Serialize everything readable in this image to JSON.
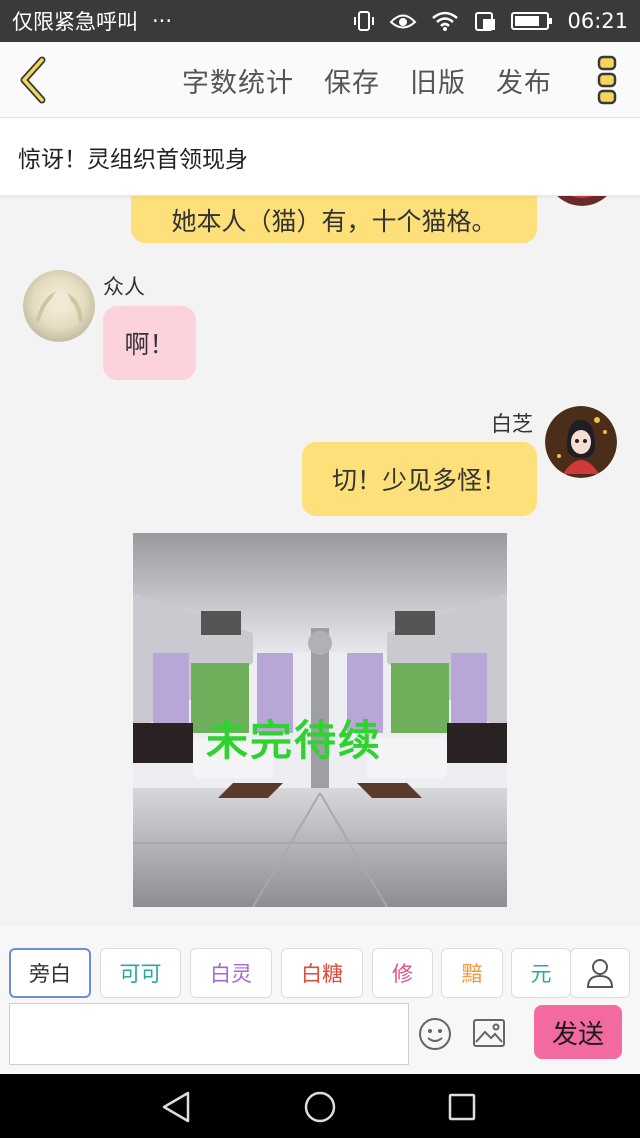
{
  "status_bar": {
    "carrier": "仅限紧急呼叫",
    "more": "···",
    "time": "06:21"
  },
  "toolbar": {
    "actions": [
      "字数统计",
      "保存",
      "旧版",
      "发布"
    ]
  },
  "chat": {
    "title": "惊讶！灵组织首领现身",
    "messages": [
      {
        "speaker": "",
        "text": "她本人（猫）有，十个猫格。",
        "side": "right"
      },
      {
        "speaker": "众人",
        "text": "啊！",
        "side": "left"
      },
      {
        "speaker": "白芝",
        "text": "切！少见多怪！",
        "side": "right"
      }
    ],
    "image_caption": "未完待续"
  },
  "roles": [
    {
      "label": "旁白",
      "color": "#333333"
    },
    {
      "label": "可可",
      "color": "#2aa8a0"
    },
    {
      "label": "白灵",
      "color": "#a667d6"
    },
    {
      "label": "白糖",
      "color": "#e24a3b"
    },
    {
      "label": "修",
      "color": "#e64a8a"
    },
    {
      "label": "黯",
      "color": "#f39a3c"
    },
    {
      "label": "元",
      "color": "#2aa8a0"
    }
  ],
  "input": {
    "value": "",
    "placeholder": "",
    "send_label": "发送"
  },
  "colors": {
    "accent_yellow": "#fde07a",
    "pink_bubble": "#fcd3dc",
    "send_button": "#f36aa0"
  }
}
